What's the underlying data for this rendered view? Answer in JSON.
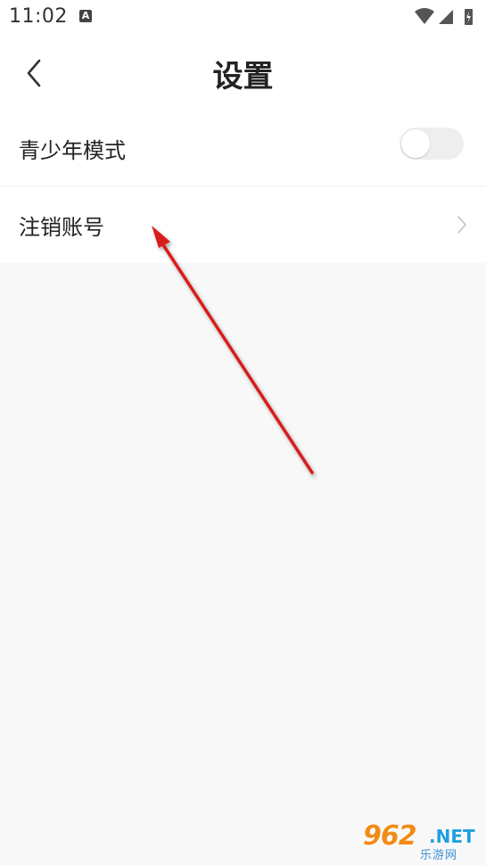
{
  "status_bar": {
    "time": "11:02",
    "notification_icon": "A"
  },
  "header": {
    "title": "设置",
    "back_icon": "chevron-left-icon"
  },
  "settings": {
    "items": [
      {
        "label": "青少年模式",
        "control": "toggle",
        "toggle_on": false
      },
      {
        "label": "注销账号",
        "control": "chevron-right-icon"
      }
    ]
  },
  "annotation": {
    "arrow_color": "#d91f1f"
  },
  "watermark": {
    "number": "962",
    "suffix": ".NET",
    "caption": "乐游网"
  }
}
